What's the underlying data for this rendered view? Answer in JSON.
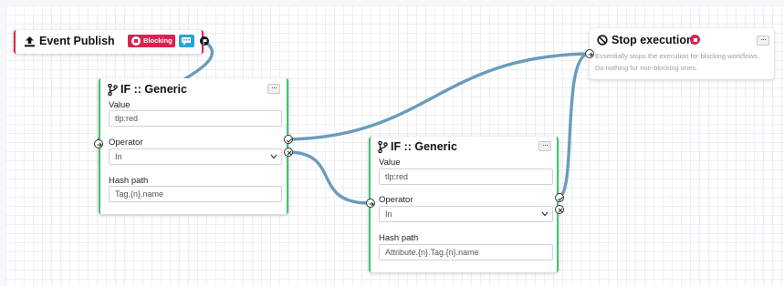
{
  "nodes": {
    "event_publish": {
      "title": "Event Publish",
      "icon": "upload-icon",
      "badge_label": "Blocking",
      "badge_color": "#d9234f",
      "chat_color": "#2aa4d4",
      "border_color": "#d9234f"
    },
    "stop_execution": {
      "title": "Stop execution",
      "menu_label": "···",
      "description_line1": "Essentially stops the execution for blocking workflows.",
      "description_line2": "Do nothing for non-blocking ones."
    },
    "if_generic_1": {
      "title": "IF :: Generic",
      "menu_label": "···",
      "value_label": "Value",
      "value": "tlp:red",
      "operator_label": "Operator",
      "operator_value": "In",
      "hash_path_label": "Hash path",
      "hash_path_value": "Tag.{n}.name",
      "border_color": "#3ec46d"
    },
    "if_generic_2": {
      "title": "IF :: Generic",
      "menu_label": "···",
      "value_label": "Value",
      "value": "tlp:red",
      "operator_label": "Operator",
      "operator_value": "In",
      "hash_path_label": "Hash path",
      "hash_path_value": "Attribute.{n}.Tag.{n}.name",
      "border_color": "#3ec46d"
    }
  },
  "colors": {
    "connection": "#6a9cbd",
    "stop_icon": "#d9234f"
  }
}
